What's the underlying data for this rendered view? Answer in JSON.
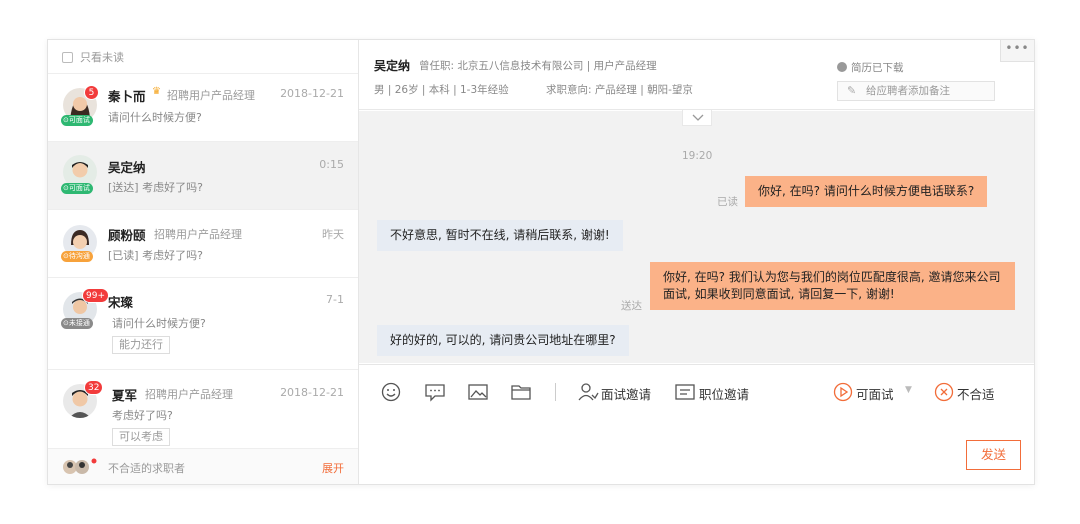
{
  "sidebar": {
    "filter_label": "只看未读",
    "items": [
      {
        "name": "秦卜而",
        "role": "招聘用户产品经理",
        "time": "2018-12-21",
        "preview": "请问什么时候方便?",
        "badge": "5",
        "tag": "可面试"
      },
      {
        "name": "吴定纳",
        "role": "",
        "time": "0:15",
        "preview": "[送达] 考虑好了吗?",
        "badge": "",
        "tag": "可面试"
      },
      {
        "name": "顾粉颐",
        "role": "招聘用户产品经理",
        "time": "昨天",
        "preview": "[已读] 考虑好了吗?",
        "badge": "",
        "tag": "待沟通"
      },
      {
        "name": "宋璨",
        "role": "",
        "time": "7-1",
        "preview": "请问什么时候方便?",
        "badge": "99+",
        "tag": "未接通",
        "chip": "能力还行"
      },
      {
        "name": "夏军",
        "role": "招聘用户产品经理",
        "time": "2018-12-21",
        "preview": "考虑好了吗?",
        "badge": "32",
        "tag": "",
        "chip": "可以考虑"
      }
    ],
    "footer_label": "不合适的求职者",
    "footer_link": "展开"
  },
  "header": {
    "name": "吴定纳",
    "previous_job": "曾任职: 北京五八信息技术有限公司 | 用户产品经理",
    "info": "男 | 26岁 | 本科 | 1-3年经验",
    "intent": "求职意向: 产品经理 | 朝阳-望京",
    "resume_status": "简历已下载",
    "note_placeholder": "给应聘者添加备注",
    "more": "•••"
  },
  "chat": {
    "timestamp": "19:20",
    "messages": [
      {
        "dir": "out",
        "text": "你好, 在吗? 请问什么时候方便电话联系?",
        "status": "已读"
      },
      {
        "dir": "in",
        "text": "不好意思, 暂时不在线, 请稍后联系, 谢谢!"
      },
      {
        "dir": "out",
        "text": "你好, 在吗? 我们认为您与我们的岗位匹配度很高, 邀请您来公司面试, 如果收到同意面试, 请回复一下, 谢谢!",
        "status": "送达"
      },
      {
        "dir": "in",
        "text": "好的好的, 可以的, 请问贵公司地址在哪里?"
      }
    ]
  },
  "toolbar": {
    "interview_invite": "面试邀请",
    "job_invite": "职位邀请",
    "can_interview": "可面试",
    "not_suitable": "不合适",
    "send": "发送"
  },
  "colors": {
    "accent": "#f26d3a",
    "out_bubble": "#fbb288",
    "in_bubble": "#e7ecf3"
  }
}
